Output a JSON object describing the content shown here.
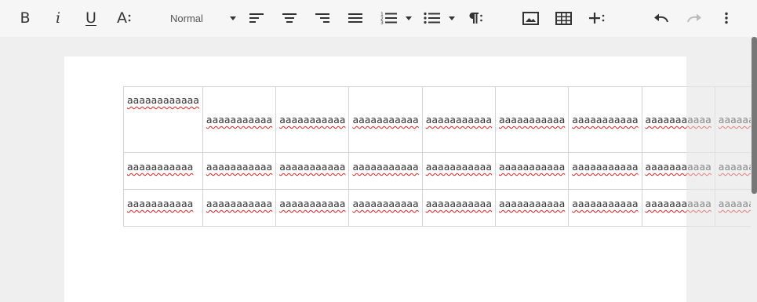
{
  "toolbar": {
    "bold_label": "B",
    "italic_label": "i",
    "underline_label": "U",
    "text_size_label": "A",
    "paragraph_style": "Normal",
    "icons": {
      "bold": "bold-icon",
      "italic": "italic-icon",
      "underline": "underline-icon",
      "text_size": "text-size-icon",
      "align_left": "align-left-icon",
      "align_center": "align-center-icon",
      "align_right": "align-right-icon",
      "justify": "justify-icon",
      "numbered_list": "numbered-list-icon",
      "bulleted_list": "bulleted-list-icon",
      "paragraph": "paragraph-icon",
      "image": "image-icon",
      "table": "table-icon",
      "insert_more": "insert-more-icon",
      "undo": "undo-icon",
      "redo": "redo-icon",
      "more": "more-vertical-icon"
    }
  },
  "document": {
    "table": {
      "rows": [
        [
          "aaaaaaaaaaaa",
          "aaaaaaaaaaa",
          "aaaaaaaaaaa",
          "aaaaaaaaaaa",
          "aaaaaaaaaaa",
          "aaaaaaaaaaa",
          "aaaaaaaaaaa",
          "aaaaaaaaaaa",
          "aaaaaaaaaaa"
        ],
        [
          "aaaaaaaaaaa",
          "aaaaaaaaaaa",
          "aaaaaaaaaaa",
          "aaaaaaaaaaa",
          "aaaaaaaaaaa",
          "aaaaaaaaaaa",
          "aaaaaaaaaaa",
          "aaaaaaaaaaa",
          "aaaaaaaaaaa"
        ],
        [
          "aaaaaaaaaaa",
          "aaaaaaaaaaa",
          "aaaaaaaaaaa",
          "aaaaaaaaaaa",
          "aaaaaaaaaaa",
          "aaaaaaaaaaa",
          "aaaaaaaaaaa",
          "aaaaaaaaaaa",
          "aaaaaaaaaaa"
        ]
      ]
    }
  },
  "colors": {
    "toolbar_bg": "#f6f6f6",
    "canvas_bg": "#efefef",
    "page_bg": "#ffffff",
    "spellcheck_underline": "#e02020",
    "icon": "#333333",
    "icon_disabled": "#bbbbbb"
  }
}
